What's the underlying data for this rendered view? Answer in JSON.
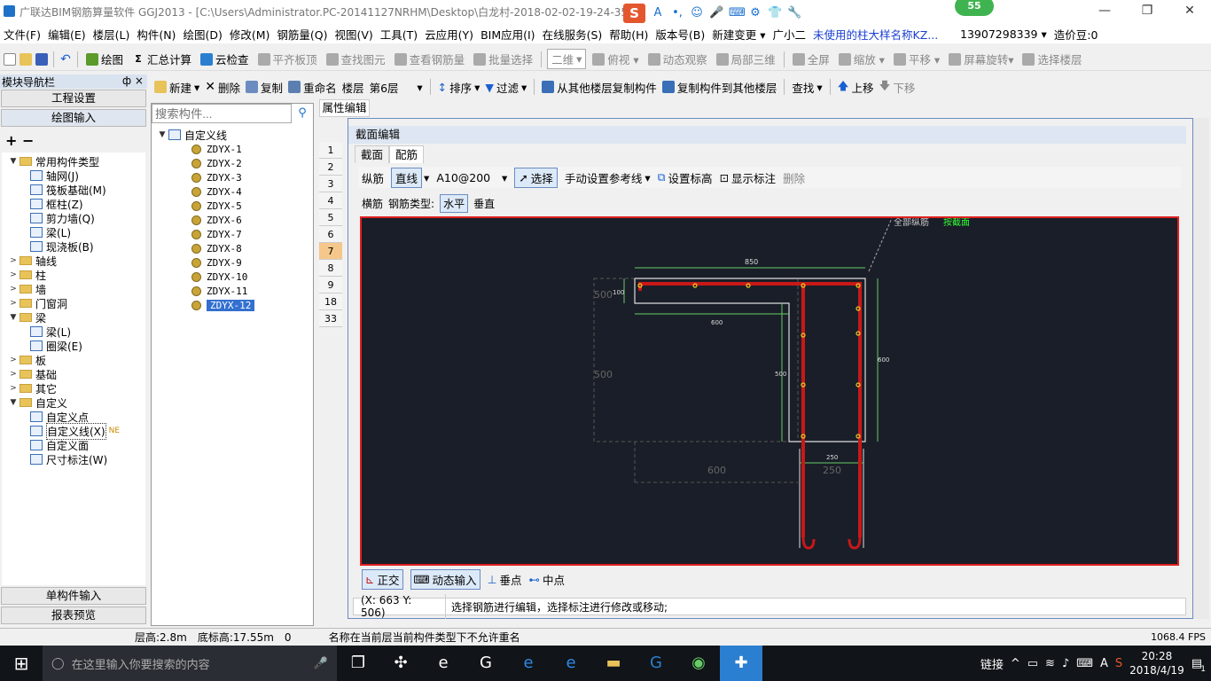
{
  "titlebar": {
    "title": "广联达BIM钢筋算量软件 GGJ2013 - [C:\\Users\\Administrator.PC-20141127NRHM\\Desktop\\白龙村-2018-02-02-19-24-35",
    "minimize": "—",
    "restore": "❐",
    "close": "✕",
    "notif_count": "55"
  },
  "sogou": {
    "logo": "S",
    "icons": [
      "A",
      "•,",
      "☺",
      "🎤",
      "⌨",
      "⚙",
      "👕",
      "🔧"
    ]
  },
  "menu": [
    "文件(F)",
    "编辑(E)",
    "楼层(L)",
    "构件(N)",
    "绘图(D)",
    "修改(M)",
    "钢筋量(Q)",
    "视图(V)",
    "工具(T)",
    "云应用(Y)",
    "BIM应用(I)",
    "在线服务(S)",
    "帮助(H)",
    "版本号(B)",
    "新建变更 ▾",
    "广小二",
    "未使用的柱大样名称KZ...",
    "13907298339 ▾",
    "造价豆:0"
  ],
  "toolbar1": [
    "绘图",
    "汇总计算",
    "云检查",
    "平齐板顶",
    "查找图元",
    "查看钢筋量",
    "批量选择",
    "二维",
    "俯视 ▾",
    "动态观察",
    "局部三维",
    "全屏",
    "缩放 ▾",
    "平移 ▾",
    "屏幕旋转▾",
    "选择楼层"
  ],
  "nav": {
    "title": "模块导航栏",
    "pin": "ф ×",
    "project_settings": "工程设置",
    "drawing_input": "绘图输入",
    "single_input": "单构件输入",
    "report_preview": "报表预览",
    "expand_all": "+",
    "collapse_all": "−"
  },
  "navtree": [
    {
      "label": "常用构件类型",
      "indent": 0,
      "type": "folder",
      "exp": "▼"
    },
    {
      "label": "轴网(J)",
      "indent": 2,
      "type": "item"
    },
    {
      "label": "筏板基础(M)",
      "indent": 2,
      "type": "item"
    },
    {
      "label": "框柱(Z)",
      "indent": 2,
      "type": "item"
    },
    {
      "label": "剪力墙(Q)",
      "indent": 2,
      "type": "item"
    },
    {
      "label": "梁(L)",
      "indent": 2,
      "type": "item"
    },
    {
      "label": "现浇板(B)",
      "indent": 2,
      "type": "item"
    },
    {
      "label": "轴线",
      "indent": 0,
      "type": "folder",
      "exp": ">"
    },
    {
      "label": "柱",
      "indent": 0,
      "type": "folder",
      "exp": ">"
    },
    {
      "label": "墙",
      "indent": 0,
      "type": "folder",
      "exp": ">"
    },
    {
      "label": "门窗洞",
      "indent": 0,
      "type": "folder",
      "exp": ">"
    },
    {
      "label": "梁",
      "indent": 0,
      "type": "folder",
      "exp": "▼"
    },
    {
      "label": "梁(L)",
      "indent": 2,
      "type": "item"
    },
    {
      "label": "圈梁(E)",
      "indent": 2,
      "type": "item"
    },
    {
      "label": "板",
      "indent": 0,
      "type": "folder",
      "exp": ">"
    },
    {
      "label": "基础",
      "indent": 0,
      "type": "folder",
      "exp": ">"
    },
    {
      "label": "其它",
      "indent": 0,
      "type": "folder",
      "exp": ">"
    },
    {
      "label": "自定义",
      "indent": 0,
      "type": "folder",
      "exp": "▼"
    },
    {
      "label": "自定义点",
      "indent": 2,
      "type": "item"
    },
    {
      "label": "自定义线(X)",
      "indent": 2,
      "type": "item",
      "selected": true,
      "tag": "NE"
    },
    {
      "label": "自定义面",
      "indent": 2,
      "type": "item"
    },
    {
      "label": "尺寸标注(W)",
      "indent": 2,
      "type": "item"
    }
  ],
  "toolbar2": {
    "new": "新建",
    "delete": "删除",
    "copy": "复制",
    "rename": "重命名",
    "floor_label": "楼层",
    "floor_value": "第6层",
    "sort": "排序",
    "filter": "过滤",
    "copy_from": "从其他楼层复制构件",
    "copy_to": "复制构件到其他楼层",
    "find": "查找",
    "up": "上移",
    "down": "下移"
  },
  "search": {
    "placeholder": "搜索构件..."
  },
  "components": {
    "root": "自定义线",
    "items": [
      "ZDYX-1",
      "ZDYX-2",
      "ZDYX-3",
      "ZDYX-4",
      "ZDYX-5",
      "ZDYX-6",
      "ZDYX-7",
      "ZDYX-8",
      "ZDYX-9",
      "ZDYX-10",
      "ZDYX-11",
      "ZDYX-12"
    ],
    "selected": "ZDYX-12"
  },
  "prop_tab": "属性编辑",
  "row_numbers": [
    "1",
    "2",
    "3",
    "4",
    "5",
    "6",
    "7",
    "8",
    "9",
    "18",
    "33"
  ],
  "dialog": {
    "title": "截面编辑",
    "tab_section": "截面",
    "tab_rebar": "配筋"
  },
  "rebar_toolbar": {
    "longitudinal": "纵筋",
    "line": "直线",
    "spec": "A10@200",
    "select": "选择",
    "manual_ref": "手动设置参考线",
    "set_elev": "设置标高",
    "show_label": "显示标注",
    "delete": "删除"
  },
  "rebar_toolbar2": {
    "transverse": "横筋",
    "type_label": "钢筋类型:",
    "horizontal": "水平",
    "vertical": "垂直"
  },
  "drawing": {
    "top_note": "全部纵筋",
    "top_note_green": "按截面",
    "dims": [
      "850",
      "100",
      "600",
      "500",
      "500",
      "600",
      "600",
      "250",
      "250",
      "500"
    ]
  },
  "bottom_toolbar": {
    "ortho": "正交",
    "dynamic": "动态输入",
    "perp": "垂点",
    "mid": "中点"
  },
  "dialog_status": {
    "coords": "(X: 663 Y: 506)",
    "message": "选择钢筋进行编辑，选择标注进行修改或移动;"
  },
  "statusbar": {
    "floor_height": "层高:2.8m",
    "base_elev": "底标高:17.55m",
    "zero": "0",
    "message": "名称在当前层当前构件类型下不允许重名",
    "fps": "1068.4 FPS"
  },
  "taskbar": {
    "search_placeholder": "在这里输入你要搜索的内容",
    "link": "链接",
    "time": "20:28",
    "date": "2018/4/19",
    "notif": "1"
  }
}
